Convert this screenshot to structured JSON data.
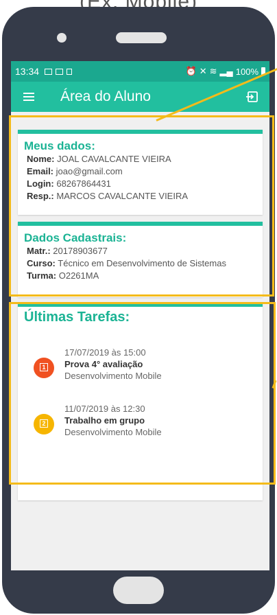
{
  "caption": "(Ex: Mobile)",
  "status_bar": {
    "time": "13:34",
    "battery": "100%"
  },
  "app_bar": {
    "title": "Área do Aluno"
  },
  "meus_dados": {
    "title": "Meus dados:",
    "rows": [
      {
        "label": "Nome:",
        "value": "JOAL CAVALCANTE VIEIRA"
      },
      {
        "label": "Email:",
        "value": "joao@gmail.com"
      },
      {
        "label": "Login:",
        "value": "68267864431"
      },
      {
        "label": "Resp.:",
        "value": "MARCOS CAVALCANTE VIEIRA"
      }
    ]
  },
  "dados_cadastrais": {
    "title": "Dados Cadastrais:",
    "rows": [
      {
        "label": "Matr.:",
        "value": "20178903677"
      },
      {
        "label": "Curso:",
        "value": "Técnico em Desenvolvimento de Sistemas"
      },
      {
        "label": "Turma:",
        "value": "O2261MA"
      }
    ]
  },
  "ultimas_tarefas": {
    "title": "Últimas Tarefas:",
    "tasks": [
      {
        "date": "17/07/2019 às 15:00",
        "title": "Prova 4° avaliação",
        "subject": "Desenvolvimento Mobile",
        "badge_number": "1"
      },
      {
        "date": "11/07/2019 às 12:30",
        "title": "Trabalho em grupo",
        "subject": "Desenvolvimento Mobile",
        "badge_number": "2"
      }
    ]
  },
  "colors": {
    "status_bar": "#1ba88f",
    "app_bar": "#22bf9f",
    "accent": "#1bb394",
    "badge_red": "#f05121",
    "badge_yellow": "#f6b500",
    "highlight": "#f4bb1a",
    "phone_body": "#353b49"
  }
}
